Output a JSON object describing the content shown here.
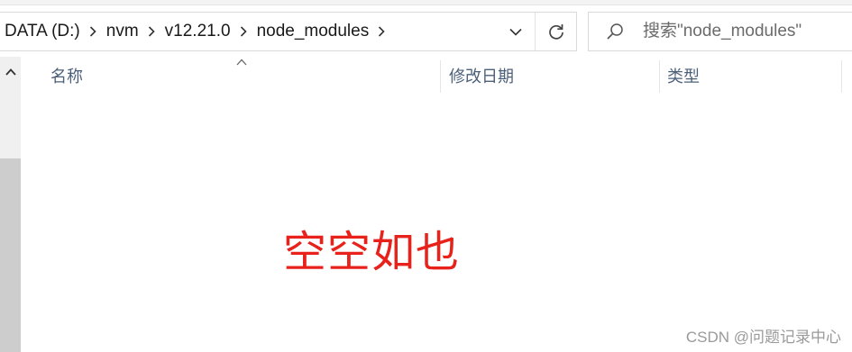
{
  "address": {
    "crumbs": [
      "DATA (D:)",
      "nvm",
      "v12.21.0",
      "node_modules"
    ],
    "dropdown_icon": "chevron-down-icon",
    "refresh_icon": "refresh-icon"
  },
  "search": {
    "placeholder": "搜索\"node_modules\"",
    "icon": "search-icon"
  },
  "columns": {
    "name": "名称",
    "date_modified": "修改日期",
    "type": "类型"
  },
  "annotation": {
    "empty_text": "空空如也",
    "color": "#e8211b"
  },
  "watermark": "CSDN @问题记录中心",
  "colors": {
    "header_text": "#4c607a",
    "scrollbar_track": "#f0f0f0",
    "scrollbar_thumb": "#cdcdcd"
  }
}
